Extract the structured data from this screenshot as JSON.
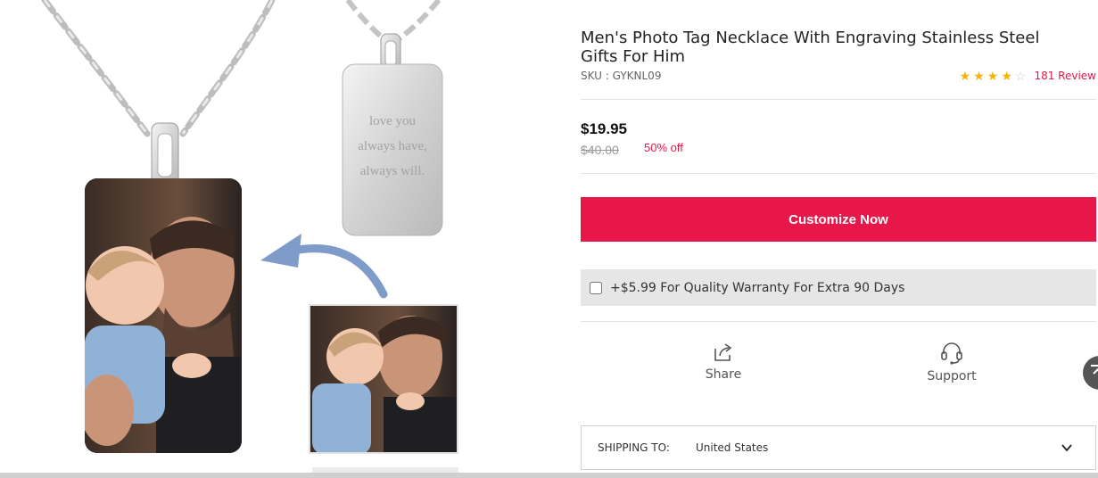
{
  "product": {
    "title": "Men's Photo Tag Necklace With Engraving Stainless Steel Gifts For Him",
    "sku_label": "SKU : GYKNL09",
    "rating": 4,
    "rating_max": 5,
    "review_link": "181 Review"
  },
  "image": {
    "engraving_lines": [
      "love you",
      "always have,",
      "always will."
    ]
  },
  "pricing": {
    "price": "$19.95",
    "original_price": "$40.00",
    "discount": "50% off"
  },
  "actions": {
    "customize_label": "Customize Now",
    "warranty_label": "+$5.99 For Quality Warranty For Extra 90 Days",
    "share_label": "Share",
    "support_label": "Support"
  },
  "shipping": {
    "label": "SHIPPING TO:",
    "country": "United States"
  },
  "colors": {
    "accent": "#e8174a",
    "star": "#f4b400"
  }
}
